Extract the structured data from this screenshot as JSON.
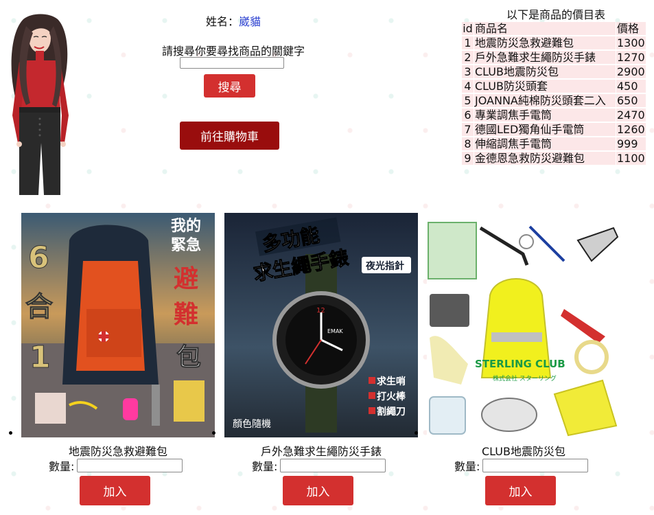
{
  "user": {
    "name_label": "姓名：",
    "name": "崴貓"
  },
  "search": {
    "label": "請搜尋你要尋找商品的關鍵字",
    "value": "",
    "placeholder": "",
    "button": "搜尋"
  },
  "cart_button": "前往購物車",
  "price_list": {
    "title": "以下是商品的價目表",
    "headers": [
      "id",
      "商品名",
      "價格"
    ],
    "rows": [
      [
        "1",
        "地震防災急救避難包",
        "1300"
      ],
      [
        "2",
        "戶外急難求生繩防災手錶",
        "1270"
      ],
      [
        "3",
        "CLUB地震防災包",
        "2900"
      ],
      [
        "4",
        "CLUB防災頭套",
        "450"
      ],
      [
        "5",
        "JOANNA純棉防災頭套二入",
        "650"
      ],
      [
        "6",
        "專業調焦手電筒",
        "2470"
      ],
      [
        "7",
        "德國LED獨角仙手電筒",
        "1260"
      ],
      [
        "8",
        "伸縮調焦手電筒",
        "999"
      ],
      [
        "9",
        "金德恩急救防災避難包",
        "1100"
      ]
    ]
  },
  "products": [
    {
      "name": "地震防災急救避難包",
      "qty_label": "數量:",
      "qty_value": "",
      "add_button": "加入",
      "image_text": {
        "left_big": "6合1",
        "right_top": "我的緊急",
        "right_red": "避難",
        "right_bottom": "包"
      }
    },
    {
      "name": "戶外急難求生繩防災手錶",
      "qty_label": "數量:",
      "qty_value": "",
      "add_button": "加入",
      "image_text": {
        "headline1": "多功能",
        "headline2": "求生繩手錶",
        "badge": "夜光指針",
        "brand": "EMAK",
        "features": [
          "求生哨",
          "打火棒",
          "割繩刀"
        ],
        "footer": "顏色隨機"
      }
    },
    {
      "name": "CLUB地震防災包",
      "qty_label": "數量:",
      "qty_value": "",
      "add_button": "加入",
      "image_text": {
        "brand": "STERLING CLUB",
        "brand_sub": "株式会社 スターリング"
      }
    }
  ],
  "colors": {
    "button_red": "#d3302f",
    "cart_dark_red": "#990d0d",
    "table_row_bg": "#fce7e8",
    "name_blue": "#2a3fd0"
  }
}
